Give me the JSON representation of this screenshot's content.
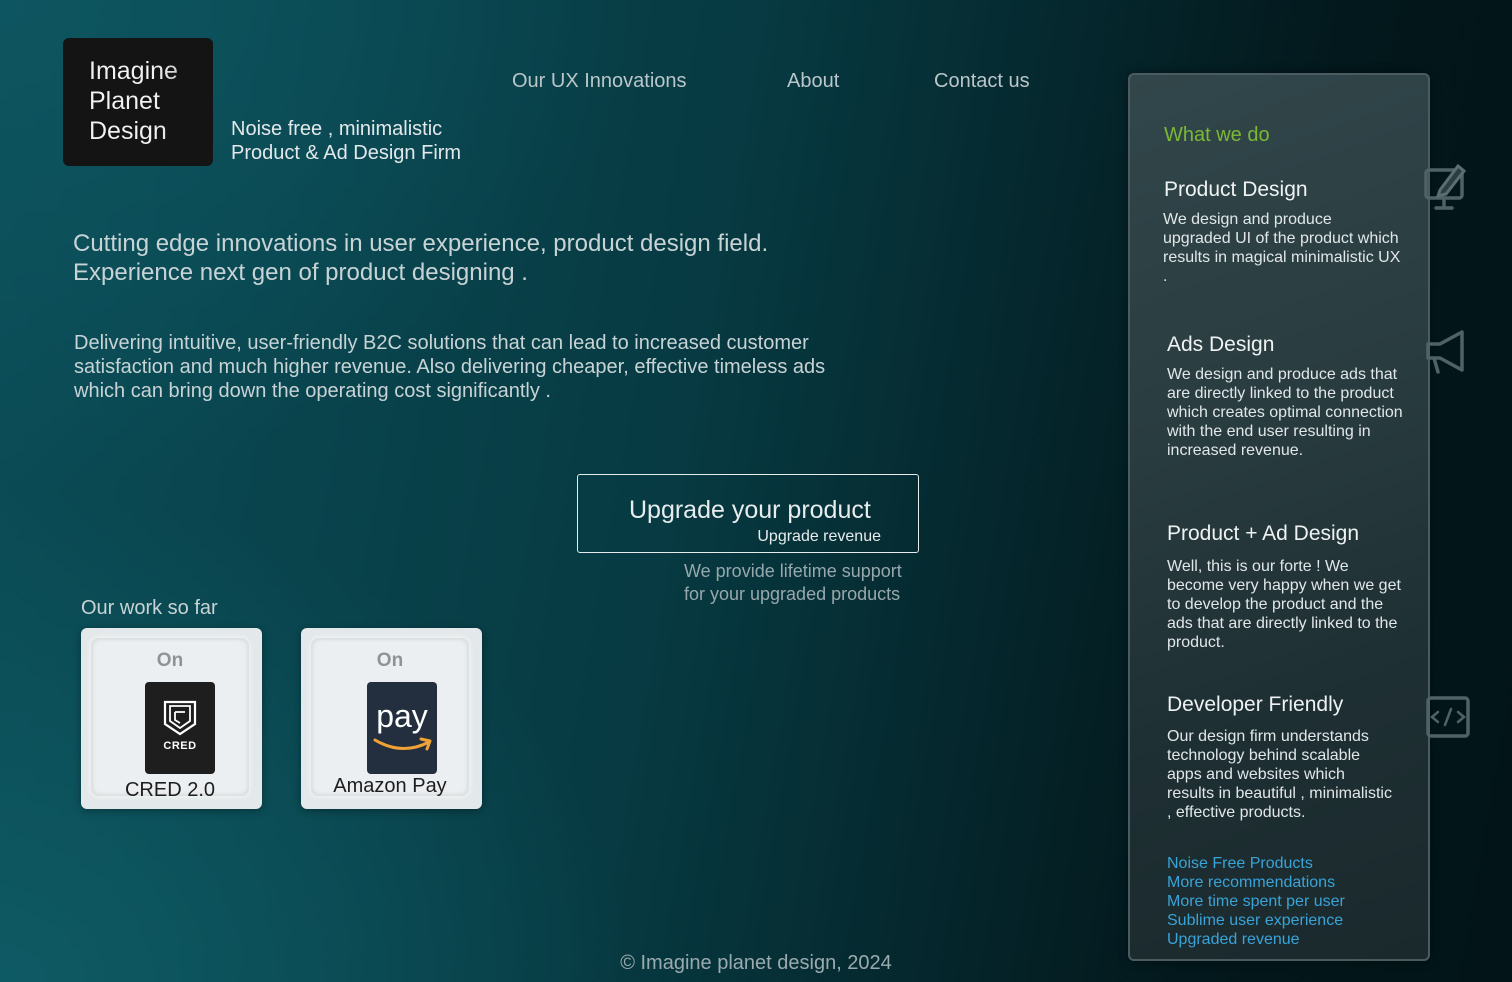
{
  "brand": {
    "logo_lines": [
      "Imagine",
      "Planet",
      "Design"
    ],
    "tagline_line1": "Noise free , minimalistic",
    "tagline_line2": "Product & Ad Design Firm"
  },
  "nav": {
    "items": [
      {
        "label": "Our UX Innovations"
      },
      {
        "label": "About"
      },
      {
        "label": "Contact us"
      }
    ]
  },
  "hero": {
    "headline": "Cutting edge innovations in user experience, product design field. Experience next gen of product designing .",
    "description": "Delivering intuitive, user-friendly B2C solutions that can lead to increased customer satisfaction and much higher revenue. Also delivering cheaper, effective timeless ads which can bring down the operating cost significantly ."
  },
  "cta": {
    "title": "Upgrade your product",
    "subtitle": "Upgrade revenue",
    "support_line1": "We provide lifetime support",
    "support_line2": "for your upgraded products"
  },
  "work": {
    "title": "Our work so far",
    "items": [
      {
        "on_label": "On",
        "logo_text": "CRED",
        "name": "CRED 2.0"
      },
      {
        "on_label": "On",
        "logo_text": "pay",
        "name": "Amazon Pay"
      }
    ]
  },
  "services": {
    "heading": "What we do",
    "items": [
      {
        "title": "Product Design",
        "body": "We design and produce upgraded UI of the product which results in magical minimalistic UX .",
        "icon": "monitor-pencil-icon"
      },
      {
        "title": "Ads Design",
        "body": "We design and produce ads that are directly linked to the product which creates optimal connection with the end user resulting in increased revenue.",
        "icon": "megaphone-icon"
      },
      {
        "title": "Product + Ad Design",
        "body": "Well, this is our forte ! We become very happy when we get to develop the product and the ads that are directly linked to the product."
      },
      {
        "title": "Developer Friendly",
        "body": "Our design firm understands technology behind scalable apps and websites which results in beautiful , minimalistic , effective products.",
        "icon": "code-icon"
      }
    ],
    "links": [
      "Noise Free Products",
      "More recommendations",
      "More time spent per user",
      "Sublime user experience",
      "Upgraded revenue"
    ]
  },
  "footer": {
    "copyright": "© Imagine planet design, 2024"
  },
  "colors": {
    "accent_green": "#7bb933",
    "link_blue": "#3aa3d8",
    "background_teal": "#0b4d57"
  }
}
